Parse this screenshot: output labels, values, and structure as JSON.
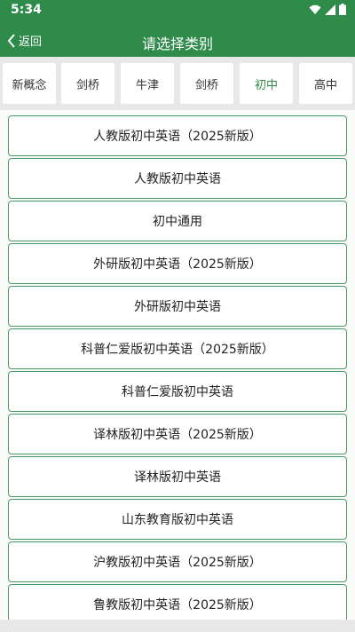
{
  "status": {
    "time": "5:34"
  },
  "header": {
    "back_label": "返回",
    "title": "请选择类别"
  },
  "tabs": [
    {
      "label": "新概念",
      "active": false
    },
    {
      "label": "剑桥",
      "active": false
    },
    {
      "label": "牛津",
      "active": false
    },
    {
      "label": "剑桥",
      "active": false
    },
    {
      "label": "初中",
      "active": true
    },
    {
      "label": "高中",
      "active": false
    }
  ],
  "categories": [
    "人教版初中英语（2025新版）",
    "人教版初中英语",
    "初中通用",
    "外研版初中英语（2025新版）",
    "外研版初中英语",
    "科普仁爱版初中英语（2025新版）",
    "科普仁爱版初中英语",
    "译林版初中英语（2025新版）",
    "译林版初中英语",
    "山东教育版初中英语",
    "沪教版初中英语（2025新版）",
    "鲁教版初中英语（2025新版）"
  ],
  "colors": {
    "brand": "#2e8b4a",
    "border": "#4a9a64"
  }
}
